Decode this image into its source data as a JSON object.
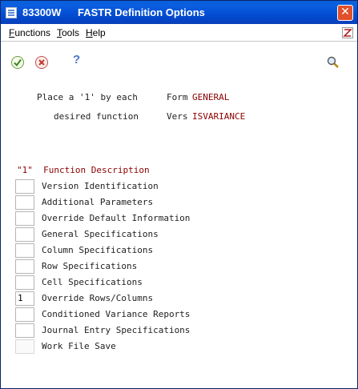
{
  "window": {
    "code": "83300W",
    "title": "FASTR Definition Options",
    "close_glyph": "✕"
  },
  "menu": {
    "items": [
      {
        "label": "Functions",
        "accel": "F"
      },
      {
        "label": "Tools",
        "accel": "T"
      },
      {
        "label": "Help",
        "accel": "H"
      }
    ]
  },
  "toolbar": {
    "ok_icon": "checkmark-icon",
    "cancel_icon": "cancel-icon",
    "help_glyph": "?",
    "search_icon": "magnifier-icon"
  },
  "header": {
    "line1_label": "Place a '1' by each",
    "line2_label": "desired function",
    "form_label": "Form",
    "form_value": "GENERAL",
    "vers_label": "Vers",
    "vers_value": "ISVARIANCE"
  },
  "list": {
    "column_header": "\"1\"  Function Description",
    "functions": [
      {
        "value": "",
        "label": "Version Identification"
      },
      {
        "value": "",
        "label": "Additional Parameters"
      },
      {
        "value": "",
        "label": "Override Default Information"
      },
      {
        "value": "",
        "label": "General Specifications"
      },
      {
        "value": "",
        "label": "Column Specifications"
      },
      {
        "value": "",
        "label": "Row Specifications"
      },
      {
        "value": "",
        "label": "Cell Specifications"
      },
      {
        "value": "1",
        "label": "Override Rows/Columns"
      },
      {
        "value": "",
        "label": "Conditioned Variance Reports"
      },
      {
        "value": "",
        "label": "Journal Entry Specifications"
      },
      {
        "value": "",
        "label": "Work File Save"
      }
    ]
  },
  "colors": {
    "title_bar": "#0553D9",
    "label_red": "#8B0000",
    "close_red": "#E1502A"
  }
}
